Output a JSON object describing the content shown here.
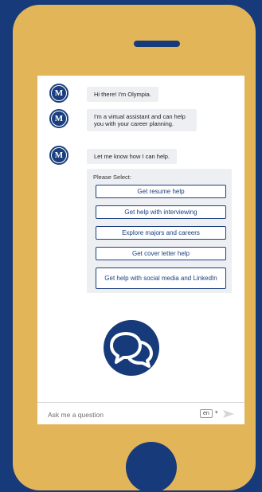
{
  "chat": {
    "messages": [
      {
        "text": "Hi there! I'm Olympia."
      },
      {
        "text": "I'm a virtual assistant and can help you with your career planning."
      },
      {
        "text": "Let me know how I can help."
      }
    ],
    "avatar_letter": "M",
    "select_label": "Please Select:",
    "options": [
      "Get resume help",
      "Get help with interviewing",
      "Explore majors and careers",
      "Get cover letter help",
      "Get help with social media and LinkedIn"
    ]
  },
  "input": {
    "placeholder": "Ask me a question",
    "language": "en"
  },
  "colors": {
    "background": "#163a7a",
    "phone_body": "#e3b559",
    "accent": "#1b3f7e",
    "bubble": "#eeeff2"
  }
}
